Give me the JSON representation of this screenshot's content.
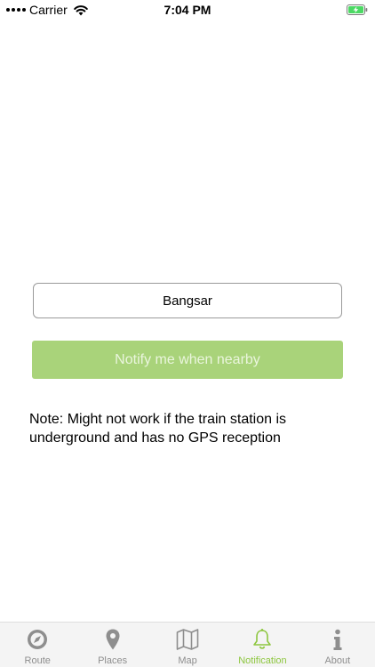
{
  "status_bar": {
    "carrier": "Carrier",
    "time": "7:04 PM"
  },
  "main": {
    "station_value": "Bangsar",
    "notify_button_label": "Notify me when nearby",
    "note": "Note: Might not work if the train station is underground and has no GPS reception"
  },
  "tab_bar": {
    "items": [
      {
        "label": "Route",
        "icon": "compass-icon",
        "active": false
      },
      {
        "label": "Places",
        "icon": "map-pin-icon",
        "active": false
      },
      {
        "label": "Map",
        "icon": "map-icon",
        "active": false
      },
      {
        "label": "Notification",
        "icon": "bell-icon",
        "active": true
      },
      {
        "label": "About",
        "icon": "info-icon",
        "active": false
      }
    ]
  },
  "colors": {
    "accent_green": "#a9d37a",
    "active_tab": "#8dc63f",
    "inactive_tab": "#8e8e8e"
  }
}
